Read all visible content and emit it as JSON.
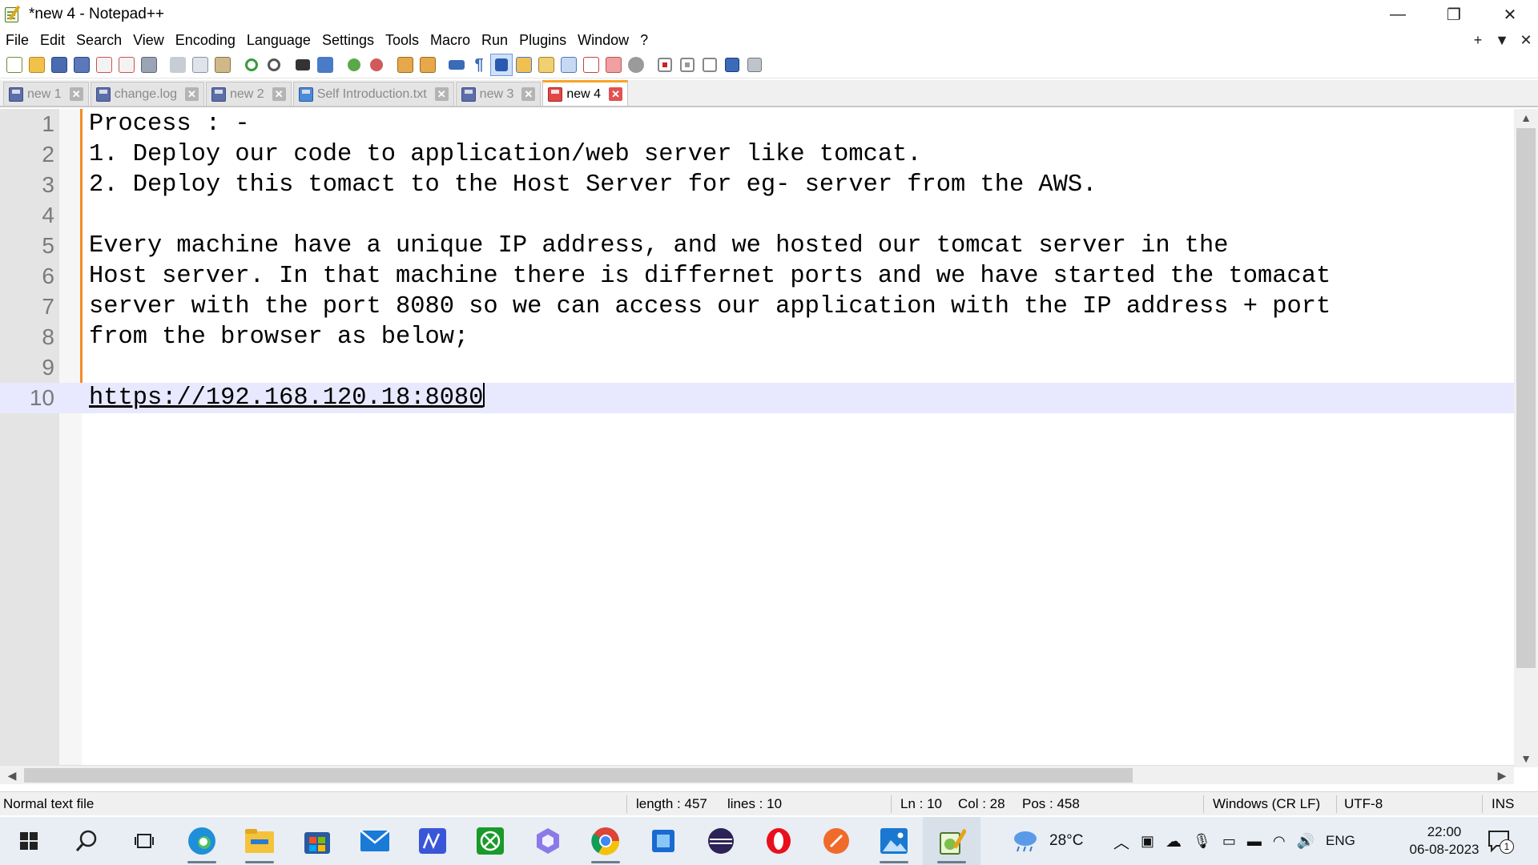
{
  "window": {
    "title": "*new 4 - Notepad++",
    "minimize": "—",
    "maximize": "❐",
    "close": "✕"
  },
  "menu": [
    "File",
    "Edit",
    "Search",
    "View",
    "Encoding",
    "Language",
    "Settings",
    "Tools",
    "Macro",
    "Run",
    "Plugins",
    "Window",
    "?"
  ],
  "menu_right": {
    "add": "+",
    "dropdown": "▼",
    "close": "✕"
  },
  "tabs": [
    {
      "label": "new 1",
      "active": false
    },
    {
      "label": "change.log",
      "active": false
    },
    {
      "label": "new 2",
      "active": false
    },
    {
      "label": "Self Introduction.txt",
      "active": false
    },
    {
      "label": "new 3",
      "active": false
    },
    {
      "label": "new 4",
      "active": true
    }
  ],
  "editor": {
    "lines": [
      {
        "n": "1",
        "text": "Process : -"
      },
      {
        "n": "2",
        "text": "1. Deploy our code to application/web server like tomcat."
      },
      {
        "n": "3",
        "text": "2. Deploy this tomact to the Host Server for eg- server from the AWS."
      },
      {
        "n": "4",
        "text": ""
      },
      {
        "n": "5",
        "text": "Every machine have a unique IP address, and we hosted our tomcat server in the"
      },
      {
        "n": "6",
        "text": "Host server. In that machine there is differnet ports and we have started the tomacat"
      },
      {
        "n": "7",
        "text": "server with the port 8080 so we can access our application with the IP address + port"
      },
      {
        "n": "8",
        "text": "from the browser as below;"
      },
      {
        "n": "9",
        "text": ""
      },
      {
        "n": "10",
        "text": "https://192.168.120.18:8080"
      }
    ],
    "current_line": 10
  },
  "status": {
    "file_type": "Normal text file",
    "length": "length : 457",
    "lines": "lines : 10",
    "ln": "Ln : 10",
    "col": "Col : 28",
    "pos": "Pos : 458",
    "eol": "Windows (CR LF)",
    "encoding": "UTF-8",
    "mode": "INS"
  },
  "taskbar": {
    "weather": "28°C",
    "language": "ENG",
    "time": "22:00",
    "date": "06-08-2023",
    "notifications": "1"
  }
}
